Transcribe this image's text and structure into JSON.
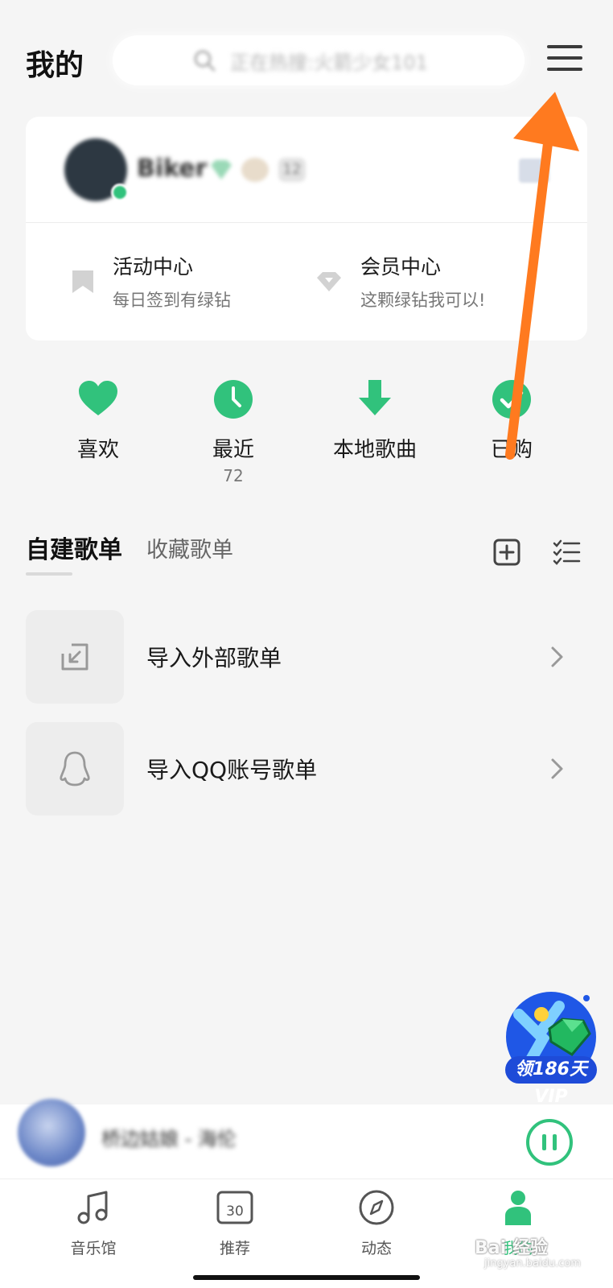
{
  "header": {
    "title": "我的",
    "search_placeholder": "正在热搜:火箭少女101"
  },
  "profile": {
    "username": "Biker",
    "level": "12",
    "entries": [
      {
        "title": "活动中心",
        "subtitle": "每日签到有绿钻"
      },
      {
        "title": "会员中心",
        "subtitle": "这颗绿钻我可以!"
      }
    ]
  },
  "quick_actions": [
    {
      "label": "喜欢",
      "icon": "heart-icon",
      "count": ""
    },
    {
      "label": "最近",
      "icon": "clock-icon",
      "count": "72"
    },
    {
      "label": "本地歌曲",
      "icon": "download-icon",
      "count": ""
    },
    {
      "label": "已购",
      "icon": "check-icon",
      "count": ""
    }
  ],
  "playlists": {
    "tabs": [
      "自建歌单",
      "收藏歌单"
    ],
    "rows": [
      {
        "label": "导入外部歌单",
        "icon": "import-icon"
      },
      {
        "label": "导入QQ账号歌单",
        "icon": "qq-penguin-icon"
      }
    ]
  },
  "vip_promo": {
    "label": "领186天VIP"
  },
  "player": {
    "track": "桥边姑娘 - 海伦",
    "state": "playing"
  },
  "tabbar": {
    "items": [
      {
        "label": "音乐馆",
        "icon": "music-note-icon",
        "active": false
      },
      {
        "label": "推荐",
        "icon": "calendar-icon",
        "badge": "30",
        "active": false
      },
      {
        "label": "动态",
        "icon": "compass-icon",
        "active": false
      },
      {
        "label": "我的",
        "icon": "person-icon",
        "active": true
      }
    ]
  },
  "watermark": {
    "text": "Bai 经验",
    "sub": "jingyan.baidu.com"
  },
  "colors": {
    "accent": "#31c27c",
    "annotation_arrow": "#ff7a1f",
    "background": "#f5f5f5"
  }
}
